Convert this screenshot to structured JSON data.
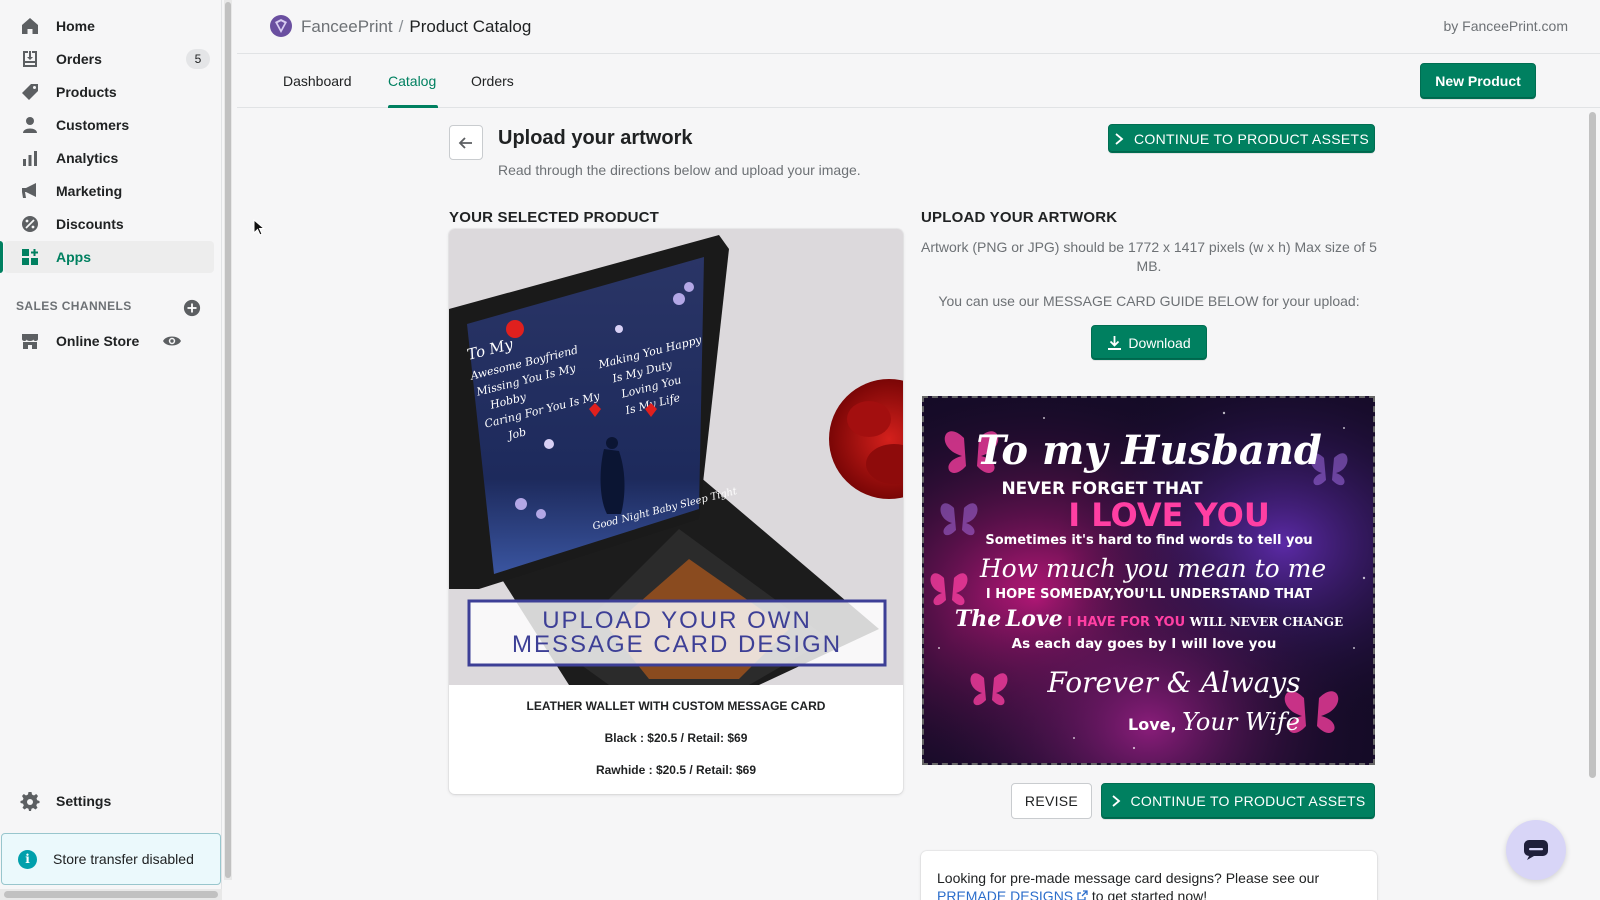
{
  "sidebar": {
    "items": [
      {
        "label": "Home",
        "icon": "home-icon"
      },
      {
        "label": "Orders",
        "icon": "orders-icon",
        "badge": "5"
      },
      {
        "label": "Products",
        "icon": "tag-icon"
      },
      {
        "label": "Customers",
        "icon": "person-icon"
      },
      {
        "label": "Analytics",
        "icon": "bar-chart-icon"
      },
      {
        "label": "Marketing",
        "icon": "megaphone-icon"
      },
      {
        "label": "Discounts",
        "icon": "discount-icon"
      },
      {
        "label": "Apps",
        "icon": "apps-icon",
        "active": true
      }
    ],
    "sales_channels_label": "SALES CHANNELS",
    "online_store_label": "Online Store",
    "settings_label": "Settings",
    "store_transfer": "Store transfer disabled"
  },
  "header": {
    "app_name": "FanceePrint",
    "separator": "/",
    "page": "Product Catalog",
    "by_line": "by FanceePrint.com"
  },
  "tabs": {
    "dashboard": "Dashboard",
    "catalog": "Catalog",
    "orders": "Orders",
    "active": "Catalog"
  },
  "new_product_label": "New Product",
  "main": {
    "title": "Upload your artwork",
    "subtitle": "Read through the directions below and upload your image.",
    "continue_label": "CONTINUE TO PRODUCT ASSETS",
    "selected_product_heading": "YOUR SELECTED PRODUCT",
    "upload_heading": "UPLOAD YOUR ARTWORK",
    "artwork_spec": "Artwork (PNG or JPG) should be 1772 x 1417 pixels (w x h) Max size of 5 MB.",
    "guide_text": "You can use our MESSAGE CARD GUIDE BELOW for your upload:",
    "download_label": "Download",
    "revise_label": "REVISE",
    "product": {
      "name": "LEATHER WALLET WITH CUSTOM MESSAGE CARD",
      "price_black": "Black : $20.5 / Retail: $69",
      "price_rawhide": "Rawhide : $20.5 / Retail: $69",
      "image_overlay_line1": "UPLOAD YOUR OWN",
      "image_overlay_line2": "MESSAGE CARD DESIGN",
      "card_left": [
        "To My",
        "Awesome Boyfriend",
        "Missing You Is My",
        "Hobby",
        "Caring For You Is My",
        "Job"
      ],
      "card_right": [
        "Making You Happy",
        "Is My Duty",
        "Loving You",
        "Is My Life"
      ],
      "card_footer": "Good Night Baby Sleep Tight"
    },
    "artwork_lines": {
      "l1": "To my Husband",
      "l2": "NEVER FORGET THAT",
      "l3": "I LOVE YOU",
      "l4": "Sometimes it's hard to find words to tell you",
      "l5": "How much you mean to me",
      "l6": "I HOPE SOMEDAY,YOU'LL UNDERSTAND THAT",
      "l7a": "The",
      "l7b": "Love",
      "l7c": "I HAVE FOR YOU",
      "l7d": "WILL NEVER CHANGE",
      "l8": "As each day goes by I will love you",
      "l9": "Forever & Always",
      "l10a": "Love,",
      "l10b": "Your Wife"
    },
    "premade": {
      "text_before": "Looking for pre-made message card designs? Please see our",
      "link": "PREMADE DESIGNS",
      "text_after": "to get started now!"
    }
  },
  "colors": {
    "accent": "#008060",
    "link": "#2c6ecb",
    "artwork_pink": "#ff3fa3"
  }
}
